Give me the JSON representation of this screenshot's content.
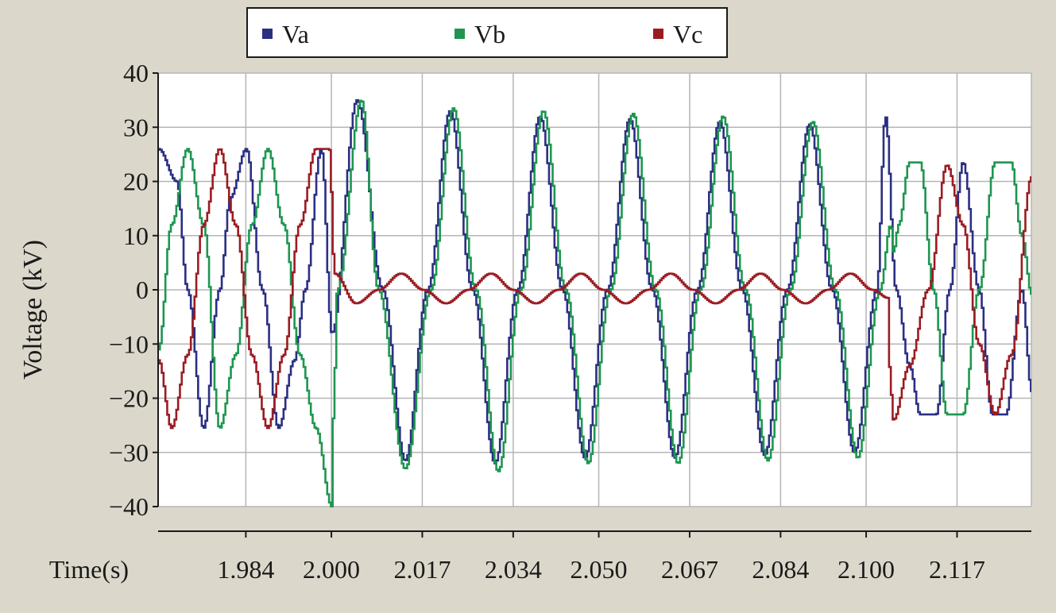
{
  "chart_data": {
    "type": "line",
    "xlabel": "Time(s)",
    "ylabel": "Voltage  (kV)",
    "ylim": [
      -40,
      40
    ],
    "yticks": [
      40,
      30,
      20,
      10,
      0,
      -10,
      -20,
      -30,
      -40
    ],
    "ytick_labels": [
      "40",
      "30",
      "20",
      "10",
      "0",
      "−10",
      "−20",
      "−30",
      "−40"
    ],
    "xlim": [
      1.9676,
      2.1309
    ],
    "xticks": [
      1.984,
      2.0,
      2.017,
      2.034,
      2.05,
      2.067,
      2.084,
      2.1,
      2.117
    ],
    "xtick_labels": [
      "1.984",
      "2.000",
      "2.017",
      "2.034",
      "2.050",
      "2.067",
      "2.084",
      "2.100",
      "2.117"
    ],
    "grid": true,
    "legend_position": "top",
    "series": [
      {
        "name": "Va",
        "color": "#2b2f82",
        "x": [
          1.9676,
          1.971,
          1.973,
          1.976,
          1.979,
          1.981,
          1.984,
          1.987,
          1.99,
          1.993,
          1.995,
          1.998,
          2.0,
          2.0047,
          2.0095,
          2.0137,
          2.0179,
          2.0221,
          2.0263,
          2.0305,
          2.0347,
          2.0389,
          2.0431,
          2.0473,
          2.0515,
          2.0557,
          2.0599,
          2.0641,
          2.0683,
          2.0725,
          2.0767,
          2.0809,
          2.0851,
          2.0893,
          2.0935,
          2.0977,
          2.1019,
          2.1035,
          2.1055,
          2.108,
          2.11,
          2.113,
          2.1155,
          2.118,
          2.121,
          2.1235,
          2.126,
          2.129,
          2.1309
        ],
        "y": [
          26,
          20,
          0,
          -25.5,
          0,
          17,
          26,
          0,
          -25.5,
          -13,
          0,
          26,
          -8,
          35,
          0,
          -31.5,
          0,
          33,
          0,
          -32,
          0,
          32,
          0,
          -31,
          0,
          31.5,
          0,
          -31,
          0,
          31,
          0,
          -30.5,
          0,
          30.5,
          0,
          -30,
          0,
          32,
          0,
          -14,
          -23,
          -23,
          0,
          23.5,
          0,
          -23,
          -23,
          0,
          -19
        ]
      },
      {
        "name": "Vb",
        "color": "#1e9650",
        "x": [
          1.9676,
          1.97,
          1.973,
          1.976,
          1.979,
          1.982,
          1.985,
          1.988,
          1.991,
          1.994,
          1.997,
          2.0,
          2.0003,
          2.001,
          2.0055,
          2.0087,
          2.0137,
          2.0185,
          2.0227,
          2.0269,
          2.0311,
          2.0353,
          2.0395,
          2.0437,
          2.0479,
          2.0521,
          2.0563,
          2.0605,
          2.0647,
          2.0689,
          2.0731,
          2.0773,
          2.0815,
          2.0857,
          2.0899,
          2.0941,
          2.0983,
          2.1025,
          2.1045,
          2.105,
          2.106,
          2.108,
          2.11,
          2.1125,
          2.115,
          2.118,
          2.121,
          2.124,
          2.127,
          2.129,
          2.1309
        ],
        "y": [
          -11,
          12,
          26,
          12,
          -25.5,
          -12,
          12,
          26,
          12,
          -12,
          -25.5,
          -40,
          -22,
          0,
          35,
          0,
          -33,
          0,
          33.5,
          0,
          -33.5,
          0,
          33,
          0,
          -32,
          0,
          32.5,
          0,
          -32,
          0,
          32,
          0,
          -31.5,
          0,
          31,
          0,
          -31,
          0,
          12,
          7,
          12,
          23.5,
          23.5,
          0,
          -23,
          -23,
          0,
          23.5,
          23.5,
          10,
          -1
        ]
      },
      {
        "name": "Vc",
        "color": "#9a1c22",
        "x": [
          1.9676,
          1.97,
          1.973,
          1.976,
          1.979,
          1.982,
          1.985,
          1.988,
          1.991,
          1.994,
          1.997,
          1.9995,
          2.0005,
          2.0045,
          2.0087,
          2.0129,
          2.0171,
          2.0213,
          2.0255,
          2.0297,
          2.0339,
          2.0381,
          2.0423,
          2.0465,
          2.0507,
          2.0549,
          2.0591,
          2.0633,
          2.0675,
          2.0717,
          2.0759,
          2.0801,
          2.0843,
          2.0885,
          2.0927,
          2.0969,
          2.1011,
          2.104,
          2.1042,
          2.105,
          2.108,
          2.1115,
          2.115,
          2.118,
          2.121,
          2.124,
          2.127,
          2.1309
        ],
        "y": [
          -13,
          -25.5,
          -12,
          12,
          26,
          12,
          -12,
          -25.5,
          -12,
          12,
          26,
          26,
          3,
          -2.5,
          0,
          3,
          0,
          -2.5,
          0,
          3,
          0,
          -2.5,
          0,
          3,
          0,
          -2.5,
          0,
          3,
          0,
          -2.5,
          0,
          3,
          0,
          -2.5,
          0,
          3,
          0,
          -1.5,
          -14,
          -24,
          -14,
          0,
          23,
          12,
          -10,
          -23,
          -12,
          21
        ]
      }
    ]
  }
}
